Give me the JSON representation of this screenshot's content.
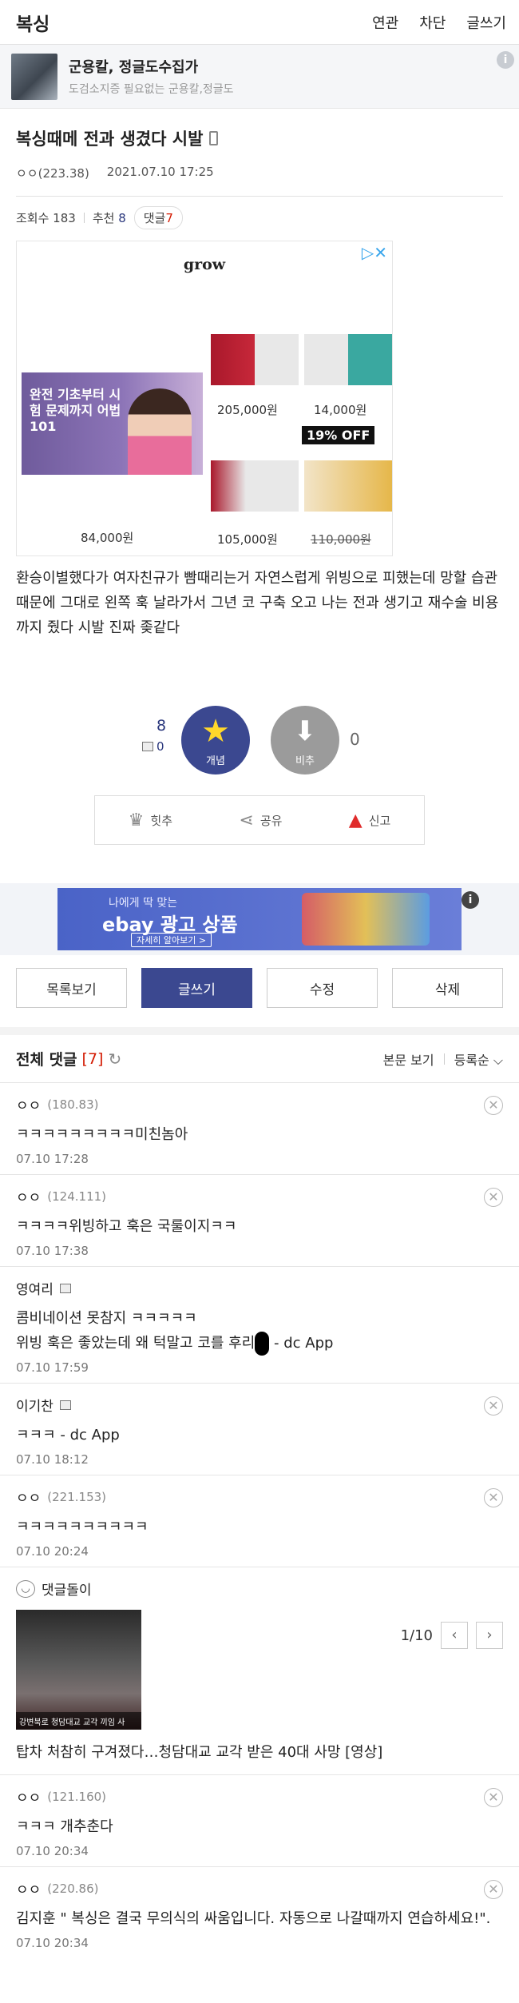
{
  "topbar": {
    "title": "복싱",
    "links": [
      "연관",
      "차단",
      "글쓰기"
    ]
  },
  "gallery": {
    "name": "군용칼, 정글도수집가",
    "desc": "도검소지증 필요없는 군용칼,정글도",
    "info": "i"
  },
  "post": {
    "title": "복싱때메 전과 생겼다 시발",
    "author": "ㅇㅇ(223.38)",
    "datetime": "2021.07.10 17:25",
    "views_label": "조회수 183",
    "recommend_label": "추천",
    "recommend_count": "8",
    "comment_label": "댓글",
    "comment_count": "7",
    "body": "환승이별했다가 여자친규가 빰때리는거 자연스럽게 위빙으로 피했는데 망할 습관 때문에 그대로 왼쪽 훅 날라가서 그년 코 구축 오고 나는 전과 생기고 재수술 비용까지 줬다 시발 진짜 좆같다"
  },
  "ad": {
    "logo": "grow",
    "main_badge": "완전 기초부터 시험 문제까지 어법 101",
    "prices": [
      "205,000원",
      "14,000원",
      "84,000원",
      "105,000원",
      "110,000원"
    ],
    "discount": "19% OFF"
  },
  "votes": {
    "up_count": "8",
    "up_mini": "0",
    "up_label": "개념",
    "down_label": "비추",
    "down_count": "0"
  },
  "actions": {
    "hit": "힛추",
    "share": "공유",
    "report": "신고"
  },
  "banner": {
    "t1": "나에게 딱 맞는",
    "t2": "ebay 광고 상품",
    "t3": "자세히 알아보기 >"
  },
  "buttons": {
    "list": "목록보기",
    "write": "글쓰기",
    "edit": "수정",
    "delete": "삭제"
  },
  "comments_header": {
    "label": "전체 댓글",
    "count": "[7]",
    "view_body": "본문 보기",
    "sort": "등록순"
  },
  "comments": [
    {
      "name": "ㅇㅇ",
      "ip": "(180.83)",
      "text": "ㅋㅋㅋㅋㅋㅋㅋㅋㅋ미친놈아",
      "date": "07.10 17:28"
    },
    {
      "name": "ㅇㅇ",
      "ip": "(124.111)",
      "text": "ㅋㅋㅋㅋ위빙하고 훅은 국룰이지ㅋㅋ",
      "date": "07.10 17:38"
    },
    {
      "name": "영여리",
      "ip": "",
      "text1": "콤비네이션 못참지 ㅋㅋㅋㅋㅋ",
      "text2a": "위빙 훅은 좋았는데 왜 턱말고 코를 후리",
      "text2b": " - dc App",
      "date": "07.10 17:59"
    },
    {
      "name": "이기찬",
      "ip": "",
      "text": "ㅋㅋㅋ - dc App",
      "date": "07.10 18:12"
    },
    {
      "name": "ㅇㅇ",
      "ip": "(221.153)",
      "text": "ㅋㅋㅋㅋㅋㅋㅋㅋㅋㅋ",
      "date": "07.10 20:24"
    },
    {
      "name": "ㅇㅇ",
      "ip": "(121.160)",
      "text": "ㅋㅋㅋ 개추춘다",
      "date": "07.10 20:34"
    },
    {
      "name": "ㅇㅇ",
      "ip": "(220.86)",
      "text": "김지훈 \" 복싱은 결국 무의식의 싸움입니다. 자동으로 나갈때까지 연습하세요!\".",
      "date": "07.10 20:34"
    }
  ],
  "bot": {
    "label": "댓글돌이",
    "page": "1/10",
    "caption": "강변북로 청담대교 교각 끼임 사",
    "headline": "탑차 처참히 구겨졌다…청담대교 교각 받은 40대 사망 [영상]"
  }
}
